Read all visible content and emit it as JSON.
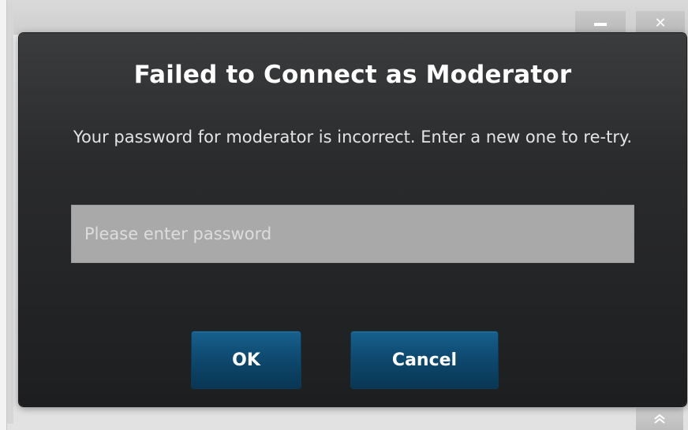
{
  "window": {
    "minimize_icon": "minimize-icon",
    "close_label": "✕",
    "scroll_icon": "double-chevron-up-icon"
  },
  "dialog": {
    "title": "Failed to Connect as Moderator",
    "message": "Your password for moderator is incorrect. Enter a new one to re-try.",
    "password_field": {
      "value": "",
      "placeholder": "Please enter password"
    },
    "buttons": {
      "ok_label": "OK",
      "cancel_label": "Cancel"
    }
  },
  "colors": {
    "dialog_bg": "#2a2b2d",
    "button_accent": "#0e4a70",
    "input_bg": "#a9a9a9"
  }
}
